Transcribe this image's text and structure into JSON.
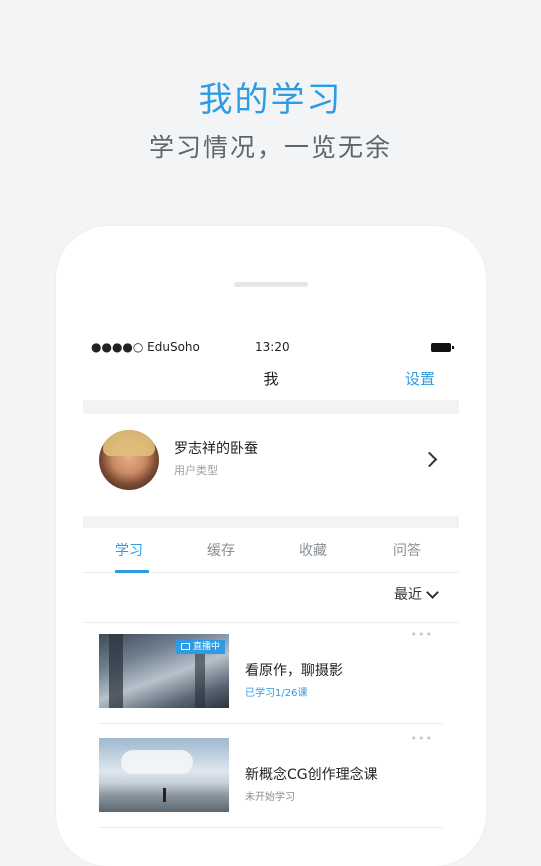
{
  "hero": {
    "title": "我的学习",
    "subtitle": "学习情况，一览无余"
  },
  "status_bar": {
    "carrier": "●●●●○ EduSoho",
    "time": "13:20"
  },
  "nav": {
    "title": "我",
    "settings_label": "设置"
  },
  "profile": {
    "name": "罗志祥的卧蚕",
    "user_type": "用户类型"
  },
  "tabs": [
    {
      "label": "学习",
      "active": true
    },
    {
      "label": "缓存",
      "active": false
    },
    {
      "label": "收藏",
      "active": false
    },
    {
      "label": "问答",
      "active": false
    }
  ],
  "sort": {
    "label": "最近"
  },
  "courses": [
    {
      "title": "看原作，聊摄影",
      "progress": "已学习1/26课",
      "badge": "直播中",
      "more": "•••"
    },
    {
      "title": "新概念CG创作理念课",
      "progress": "未开始学习",
      "more": "•••"
    }
  ],
  "colors": {
    "accent": "#2f9be3",
    "background": "#f3f4f6",
    "text_primary": "#222222",
    "text_secondary": "#9aa0a6"
  }
}
